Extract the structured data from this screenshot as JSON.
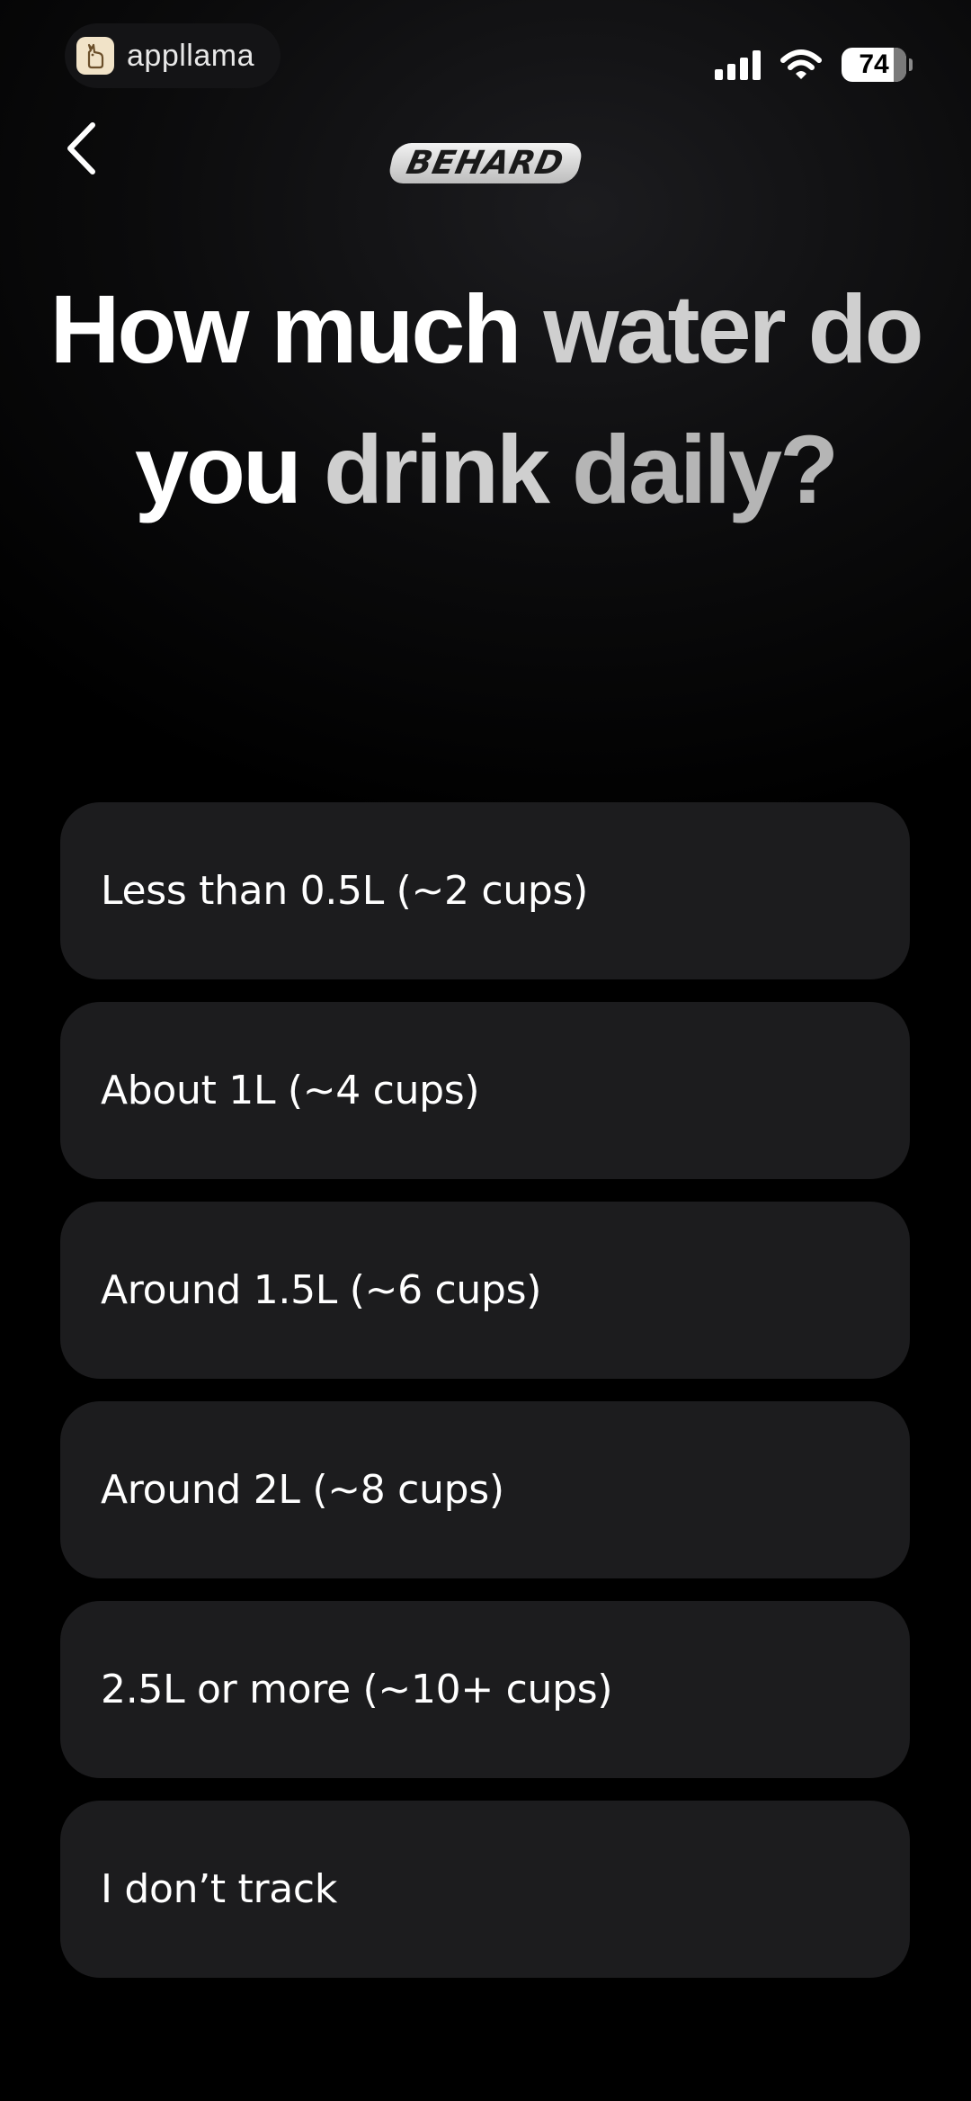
{
  "status_bar": {
    "app_name": "appllama",
    "battery": "74"
  },
  "header": {
    "brand": "BEHARD"
  },
  "title": {
    "part1": "How much ",
    "part2": "water do",
    "part3": "you ",
    "part4": "drink ",
    "part5": "daily?"
  },
  "options": [
    {
      "label": "Less than 0.5L (~2 cups)"
    },
    {
      "label": "About 1L (~4 cups)"
    },
    {
      "label": "Around 1.5L (~6 cups)"
    },
    {
      "label": "Around 2L (~8 cups)"
    },
    {
      "label": "2.5L or more (~10+ cups)"
    },
    {
      "label": "I don’t track"
    }
  ],
  "colors": {
    "background": "#000000",
    "option_background": "#1c1c1e",
    "text_primary": "#ffffff",
    "text_muted": "#b5b5b5"
  }
}
